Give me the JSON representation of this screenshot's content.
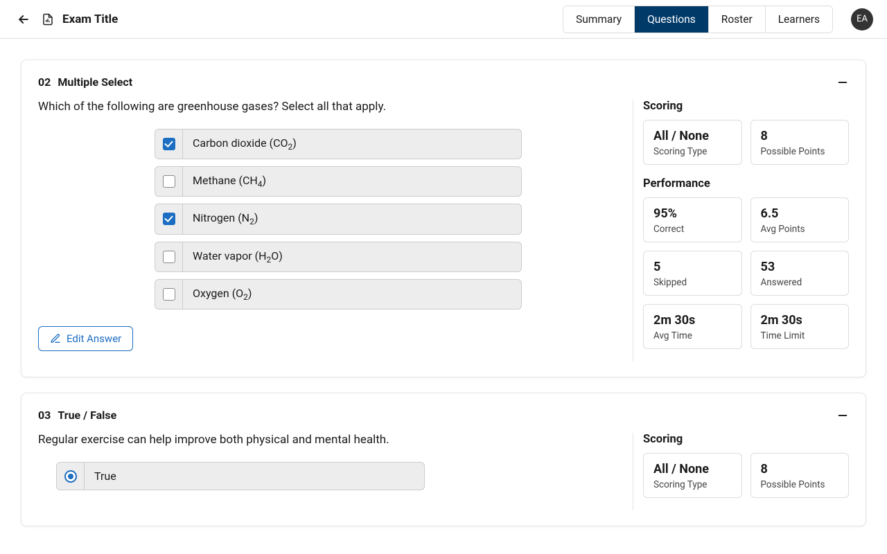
{
  "header": {
    "title": "Exam Title",
    "avatar_initials": "EA",
    "tabs": [
      "Summary",
      "Questions",
      "Roster",
      "Learners"
    ],
    "active_tab_index": 1
  },
  "questions": [
    {
      "number": "02",
      "type_label": "Multiple Select",
      "prompt": "Which of the following are greenhouse gases? Select all that apply.",
      "input_kind": "checkbox",
      "options": [
        {
          "html": "Carbon dioxide (CO<sub>2</sub>)",
          "checked": true
        },
        {
          "html": "Methane (CH<sub>4</sub>)",
          "checked": false
        },
        {
          "html": "Nitrogen (N<sub>2</sub>)",
          "checked": true
        },
        {
          "html": "Water vapor (H<sub>2</sub>O)",
          "checked": false
        },
        {
          "html": "Oxygen (O<sub>2</sub>)",
          "checked": false
        }
      ],
      "edit_button_label": "Edit Answer",
      "scoring_title": "Scoring",
      "scoring": [
        {
          "value": "All / None",
          "label": "Scoring Type"
        },
        {
          "value": "8",
          "label": "Possible Points"
        }
      ],
      "performance_title": "Performance",
      "performance": [
        {
          "value": "95%",
          "label": "Correct"
        },
        {
          "value": "6.5",
          "label": "Avg Points"
        },
        {
          "value": "5",
          "label": "Skipped"
        },
        {
          "value": "53",
          "label": "Answered"
        },
        {
          "value": "2m 30s",
          "label": "Avg Time"
        },
        {
          "value": "2m 30s",
          "label": "Time Limit"
        }
      ]
    },
    {
      "number": "03",
      "type_label": "True / False",
      "prompt": "Regular exercise can help improve both physical and mental health.",
      "input_kind": "radio",
      "options_narrow": true,
      "options": [
        {
          "html": "True",
          "checked": true
        }
      ],
      "scoring_title": "Scoring",
      "scoring": [
        {
          "value": "All / None",
          "label": "Scoring Type"
        },
        {
          "value": "8",
          "label": "Possible Points"
        }
      ]
    }
  ]
}
